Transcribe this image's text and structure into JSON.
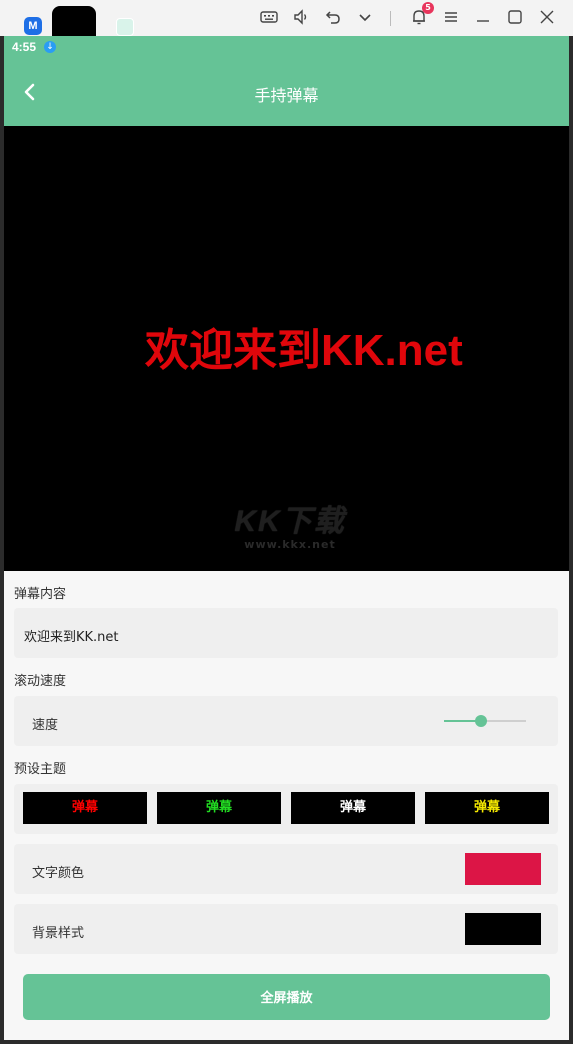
{
  "system_bar": {
    "app_icon_label": "M",
    "notification_count": "5",
    "icons": [
      "keyboard-icon",
      "volume-icon",
      "undo-icon",
      "chevron-down-icon",
      "bell-icon",
      "menu-icon",
      "minimize-icon",
      "maximize-icon",
      "close-icon"
    ]
  },
  "status": {
    "time": "4:55"
  },
  "header": {
    "title": "手持弹幕"
  },
  "preview": {
    "text": "欢迎来到KK.net",
    "text_color": "#e0060b",
    "background": "#000000",
    "watermark_logo": "KK下载",
    "watermark_url": "www.kkx.net"
  },
  "content": {
    "label": "弹幕内容",
    "value": "欢迎来到KK.net"
  },
  "speed": {
    "section_label": "滚动速度",
    "row_label": "速度",
    "value": 0.45
  },
  "themes": {
    "section_label": "预设主题",
    "items": [
      {
        "label": "弹幕",
        "color": "#ff0000"
      },
      {
        "label": "弹幕",
        "color": "#22dd22"
      },
      {
        "label": "弹幕",
        "color": "#ffffff"
      },
      {
        "label": "弹幕",
        "color": "#f5e800"
      }
    ]
  },
  "text_color": {
    "label": "文字颜色",
    "color": "#dc1546"
  },
  "background_style": {
    "label": "背景样式",
    "color": "#000000"
  },
  "fullscreen_button": {
    "label": "全屏播放"
  },
  "accent": "#65c396"
}
